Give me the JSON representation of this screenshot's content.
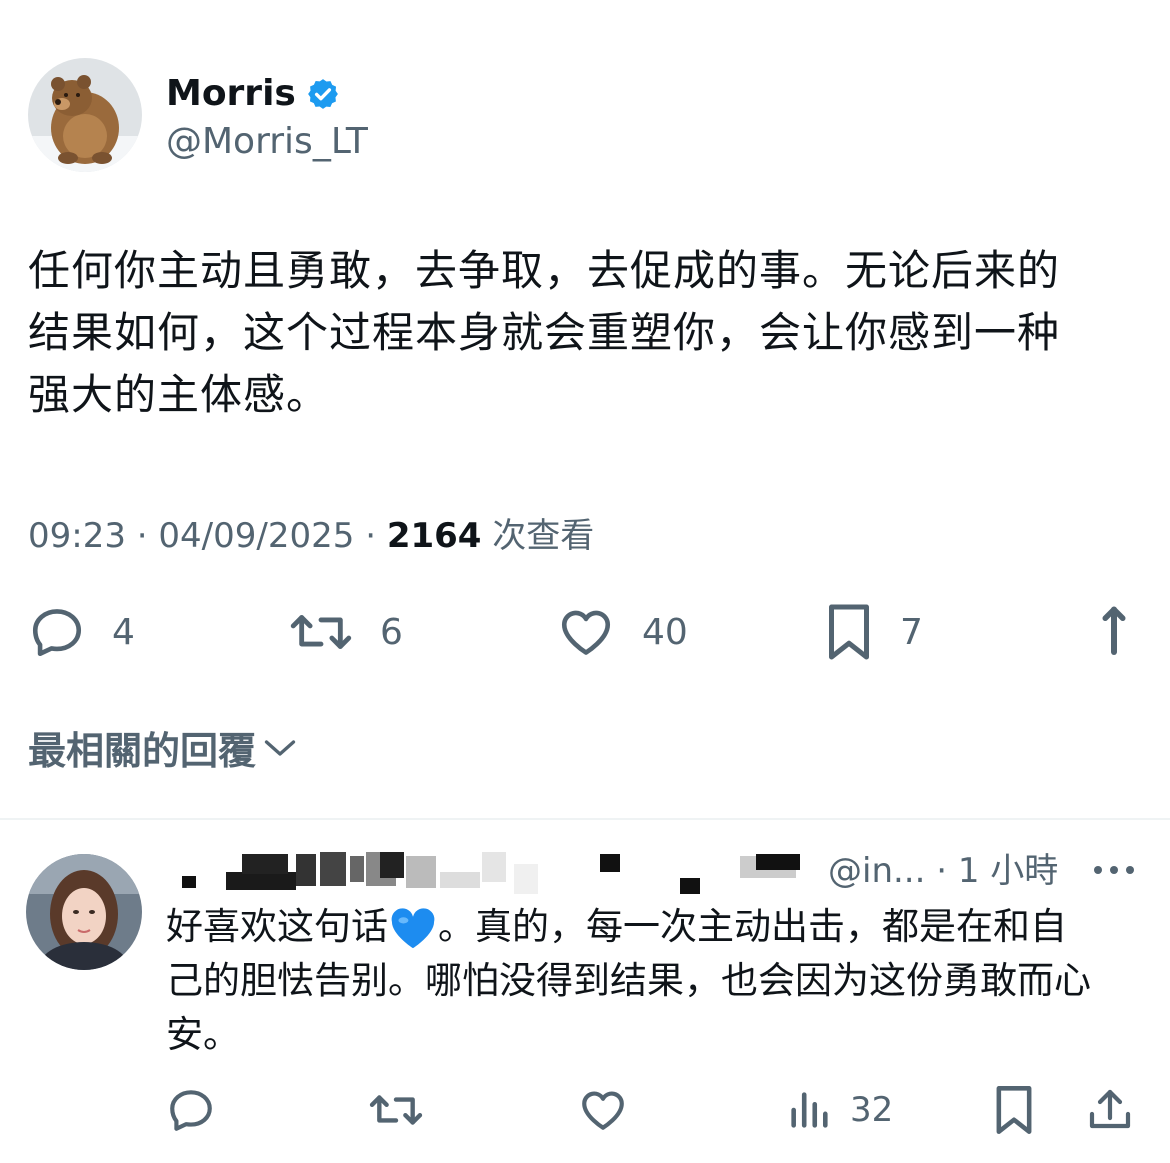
{
  "author": {
    "display_name": "Morris",
    "handle": "@Morris_LT",
    "verified": true,
    "avatar": "brown-bear-in-snow"
  },
  "tweet": {
    "text_lines": [
      "任何你主动且勇敢，去争取，去促成的事。无论后来的",
      "结果如何，这个过程本身就会重塑你，会让你感到一种",
      "强大的主体感。"
    ],
    "time": "09:23",
    "date": "04/09/2025",
    "views_count": "2164",
    "views_label": "次查看",
    "separator": "·"
  },
  "actions": {
    "reply_count": "4",
    "retweet_count": "6",
    "like_count": "40",
    "bookmark_count": "7"
  },
  "replies_sort_label": "最相關的回覆",
  "reply": {
    "handle": "@in...",
    "time_ago": "1 小時",
    "separator": "·",
    "text_line1_a": "好喜欢这句话",
    "text_line1_b": "。真的，每一次主动出击，都是在和自",
    "text_line2": "己的胆怯告别。哪怕没得到结果，也会因为这份勇敢而心",
    "text_line3": "安。",
    "emoji": "blue-heart",
    "views_count": "32"
  },
  "colors": {
    "text_primary": "#0f1419",
    "text_secondary": "#536471",
    "verified_blue": "#1d9bf0",
    "divider": "#eff3f4"
  }
}
